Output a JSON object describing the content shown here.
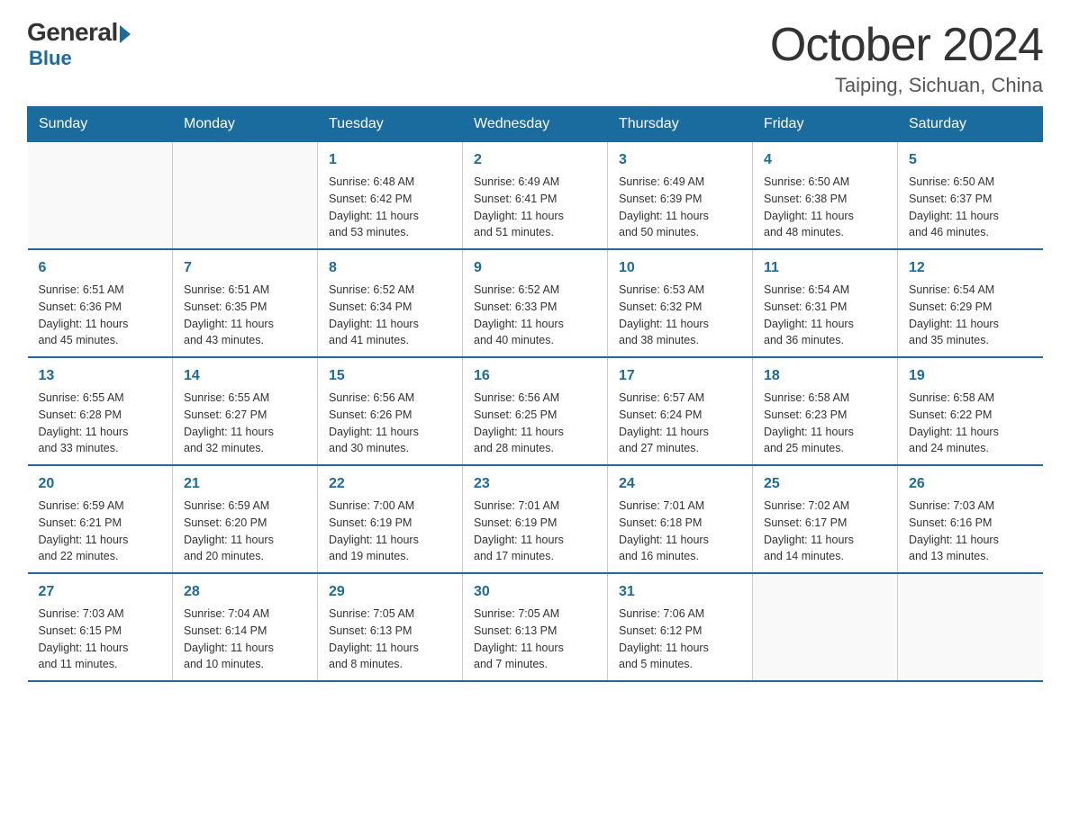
{
  "logo": {
    "general": "General",
    "blue": "Blue",
    "bottom": "Blue"
  },
  "title": "October 2024",
  "location": "Taiping, Sichuan, China",
  "days_of_week": [
    "Sunday",
    "Monday",
    "Tuesday",
    "Wednesday",
    "Thursday",
    "Friday",
    "Saturday"
  ],
  "weeks": [
    [
      {
        "day": "",
        "info": ""
      },
      {
        "day": "",
        "info": ""
      },
      {
        "day": "1",
        "info": "Sunrise: 6:48 AM\nSunset: 6:42 PM\nDaylight: 11 hours\nand 53 minutes."
      },
      {
        "day": "2",
        "info": "Sunrise: 6:49 AM\nSunset: 6:41 PM\nDaylight: 11 hours\nand 51 minutes."
      },
      {
        "day": "3",
        "info": "Sunrise: 6:49 AM\nSunset: 6:39 PM\nDaylight: 11 hours\nand 50 minutes."
      },
      {
        "day": "4",
        "info": "Sunrise: 6:50 AM\nSunset: 6:38 PM\nDaylight: 11 hours\nand 48 minutes."
      },
      {
        "day": "5",
        "info": "Sunrise: 6:50 AM\nSunset: 6:37 PM\nDaylight: 11 hours\nand 46 minutes."
      }
    ],
    [
      {
        "day": "6",
        "info": "Sunrise: 6:51 AM\nSunset: 6:36 PM\nDaylight: 11 hours\nand 45 minutes."
      },
      {
        "day": "7",
        "info": "Sunrise: 6:51 AM\nSunset: 6:35 PM\nDaylight: 11 hours\nand 43 minutes."
      },
      {
        "day": "8",
        "info": "Sunrise: 6:52 AM\nSunset: 6:34 PM\nDaylight: 11 hours\nand 41 minutes."
      },
      {
        "day": "9",
        "info": "Sunrise: 6:52 AM\nSunset: 6:33 PM\nDaylight: 11 hours\nand 40 minutes."
      },
      {
        "day": "10",
        "info": "Sunrise: 6:53 AM\nSunset: 6:32 PM\nDaylight: 11 hours\nand 38 minutes."
      },
      {
        "day": "11",
        "info": "Sunrise: 6:54 AM\nSunset: 6:31 PM\nDaylight: 11 hours\nand 36 minutes."
      },
      {
        "day": "12",
        "info": "Sunrise: 6:54 AM\nSunset: 6:29 PM\nDaylight: 11 hours\nand 35 minutes."
      }
    ],
    [
      {
        "day": "13",
        "info": "Sunrise: 6:55 AM\nSunset: 6:28 PM\nDaylight: 11 hours\nand 33 minutes."
      },
      {
        "day": "14",
        "info": "Sunrise: 6:55 AM\nSunset: 6:27 PM\nDaylight: 11 hours\nand 32 minutes."
      },
      {
        "day": "15",
        "info": "Sunrise: 6:56 AM\nSunset: 6:26 PM\nDaylight: 11 hours\nand 30 minutes."
      },
      {
        "day": "16",
        "info": "Sunrise: 6:56 AM\nSunset: 6:25 PM\nDaylight: 11 hours\nand 28 minutes."
      },
      {
        "day": "17",
        "info": "Sunrise: 6:57 AM\nSunset: 6:24 PM\nDaylight: 11 hours\nand 27 minutes."
      },
      {
        "day": "18",
        "info": "Sunrise: 6:58 AM\nSunset: 6:23 PM\nDaylight: 11 hours\nand 25 minutes."
      },
      {
        "day": "19",
        "info": "Sunrise: 6:58 AM\nSunset: 6:22 PM\nDaylight: 11 hours\nand 24 minutes."
      }
    ],
    [
      {
        "day": "20",
        "info": "Sunrise: 6:59 AM\nSunset: 6:21 PM\nDaylight: 11 hours\nand 22 minutes."
      },
      {
        "day": "21",
        "info": "Sunrise: 6:59 AM\nSunset: 6:20 PM\nDaylight: 11 hours\nand 20 minutes."
      },
      {
        "day": "22",
        "info": "Sunrise: 7:00 AM\nSunset: 6:19 PM\nDaylight: 11 hours\nand 19 minutes."
      },
      {
        "day": "23",
        "info": "Sunrise: 7:01 AM\nSunset: 6:19 PM\nDaylight: 11 hours\nand 17 minutes."
      },
      {
        "day": "24",
        "info": "Sunrise: 7:01 AM\nSunset: 6:18 PM\nDaylight: 11 hours\nand 16 minutes."
      },
      {
        "day": "25",
        "info": "Sunrise: 7:02 AM\nSunset: 6:17 PM\nDaylight: 11 hours\nand 14 minutes."
      },
      {
        "day": "26",
        "info": "Sunrise: 7:03 AM\nSunset: 6:16 PM\nDaylight: 11 hours\nand 13 minutes."
      }
    ],
    [
      {
        "day": "27",
        "info": "Sunrise: 7:03 AM\nSunset: 6:15 PM\nDaylight: 11 hours\nand 11 minutes."
      },
      {
        "day": "28",
        "info": "Sunrise: 7:04 AM\nSunset: 6:14 PM\nDaylight: 11 hours\nand 10 minutes."
      },
      {
        "day": "29",
        "info": "Sunrise: 7:05 AM\nSunset: 6:13 PM\nDaylight: 11 hours\nand 8 minutes."
      },
      {
        "day": "30",
        "info": "Sunrise: 7:05 AM\nSunset: 6:13 PM\nDaylight: 11 hours\nand 7 minutes."
      },
      {
        "day": "31",
        "info": "Sunrise: 7:06 AM\nSunset: 6:12 PM\nDaylight: 11 hours\nand 5 minutes."
      },
      {
        "day": "",
        "info": ""
      },
      {
        "day": "",
        "info": ""
      }
    ]
  ]
}
